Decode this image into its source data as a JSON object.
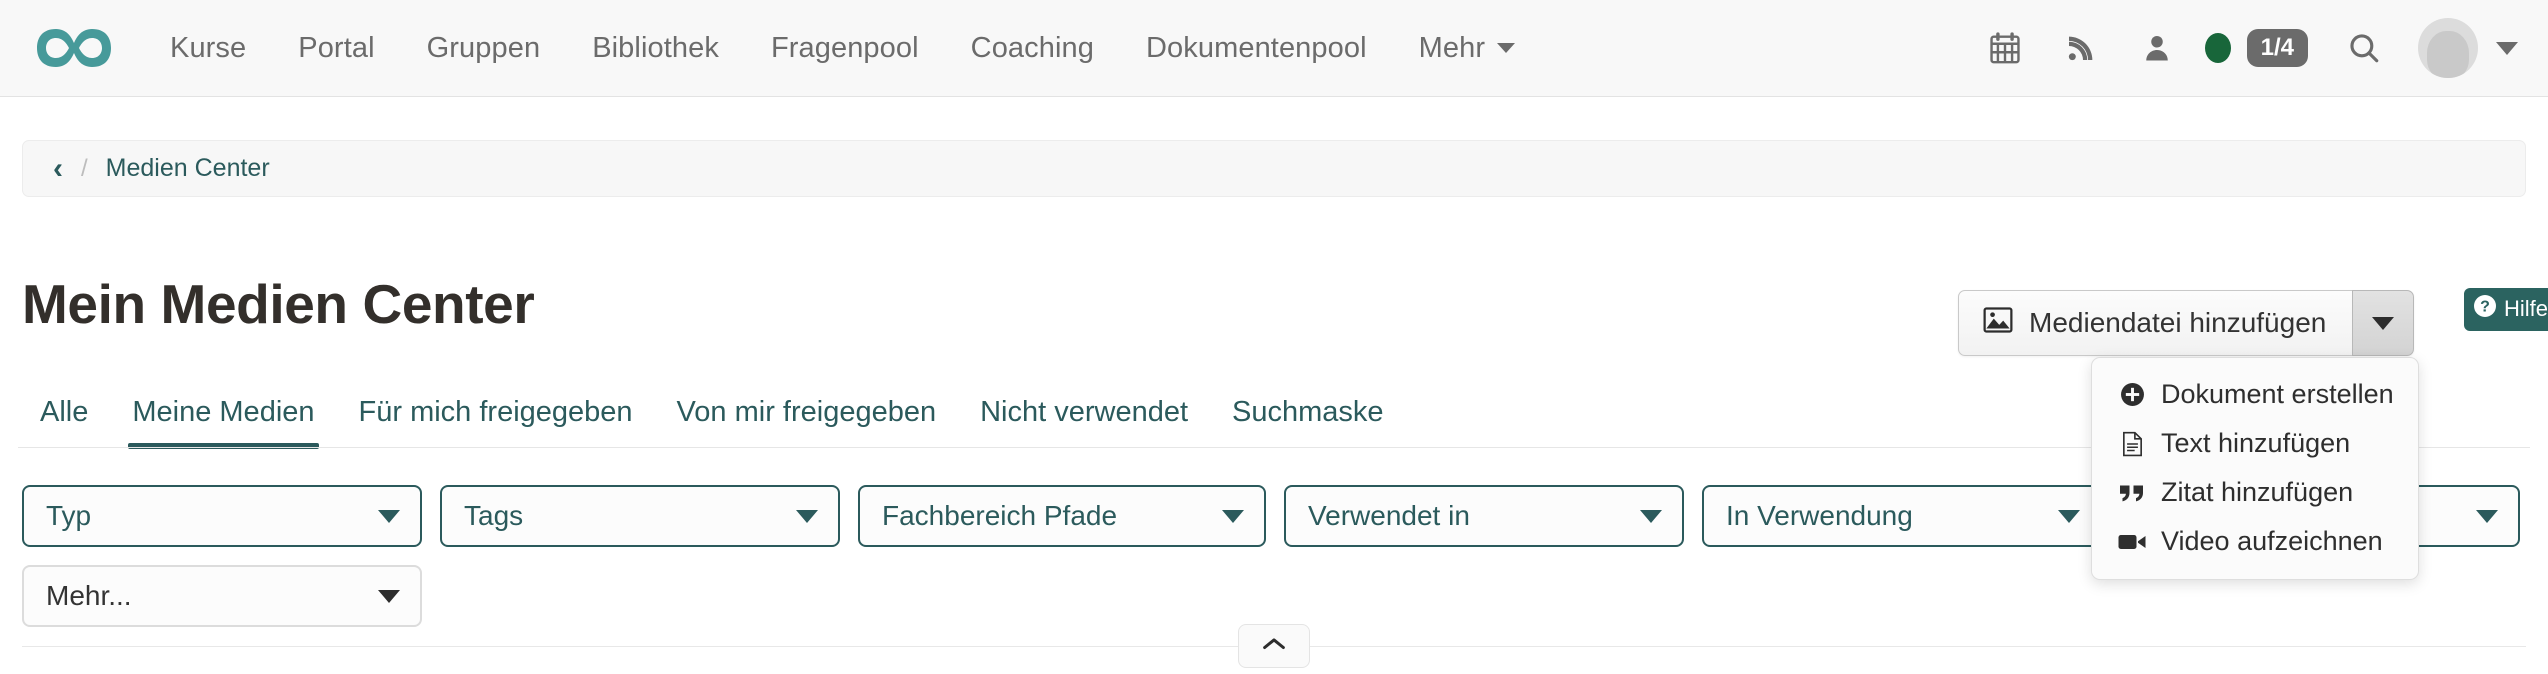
{
  "navbar": {
    "brand_icon": "infinity-logo",
    "links": [
      "Kurse",
      "Portal",
      "Gruppen",
      "Bibliothek",
      "Fragenpool",
      "Coaching",
      "Dokumentenpool"
    ],
    "more_label": "Mehr",
    "icons": [
      "calendar-icon",
      "rss-icon",
      "user-icon"
    ],
    "status_dot_color": "#18663a",
    "count_badge": "1/4",
    "search_icon": "search-icon",
    "avatar": "avatar"
  },
  "breadcrumb": {
    "back_glyph": "‹",
    "separator": "/",
    "items": [
      "Medien Center"
    ]
  },
  "page": {
    "title": "Mein Medien Center"
  },
  "add_button": {
    "icon": "image-icon",
    "label": "Mediendatei hinzufügen",
    "toggle_icon": "caret-down-icon"
  },
  "help_button": {
    "icon": "question-circle-icon",
    "label": "Hilfe"
  },
  "tabs": [
    {
      "label": "Alle",
      "active": false
    },
    {
      "label": "Meine Medien",
      "active": true
    },
    {
      "label": "Für mich freigegeben",
      "active": false
    },
    {
      "label": "Von mir freigegeben",
      "active": false
    },
    {
      "label": "Nicht verwendet",
      "active": false
    },
    {
      "label": "Suchmaske",
      "active": false
    }
  ],
  "filters": [
    {
      "label": "Typ"
    },
    {
      "label": "Tags"
    },
    {
      "label": "Fachbereich Pfade"
    },
    {
      "label": "Verwendet in"
    },
    {
      "label": "In Verwendung"
    },
    {
      "label": ""
    },
    {
      "label": "Mehr..."
    }
  ],
  "dropdown_menu": {
    "items": [
      {
        "icon": "plus-circle-icon",
        "label": "Dokument erstellen"
      },
      {
        "icon": "file-text-icon",
        "label": "Text hinzufügen"
      },
      {
        "icon": "quote-left-icon",
        "label": "Zitat hinzufügen"
      },
      {
        "icon": "video-camera-icon",
        "label": "Video aufzeichnen"
      }
    ]
  },
  "collapse": {
    "icon": "chevron-up-icon"
  },
  "colors": {
    "teal": "#2b5a5c",
    "brand_teal": "#479a9a",
    "help_teal": "#2b6360",
    "status_green": "#18663a",
    "navbar_bg": "#f8f8f8"
  }
}
